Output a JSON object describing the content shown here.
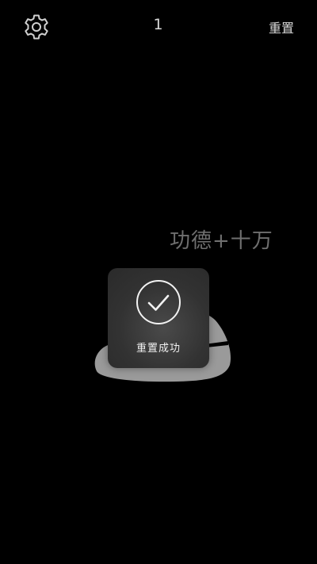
{
  "header": {
    "settings_icon": "gear-icon",
    "counter": "1",
    "reset_label": "重置"
  },
  "main": {
    "merit_text": "功德+十万",
    "fish_icon": "wooden-fish-icon"
  },
  "toast": {
    "icon": "check-circle-icon",
    "message": "重置成功"
  },
  "colors": {
    "background": "#000000",
    "header_text": "#d8d8d8",
    "merit_text": "#6f6f6f",
    "fish": "#9a9a9a",
    "toast_bg": "#333333"
  }
}
